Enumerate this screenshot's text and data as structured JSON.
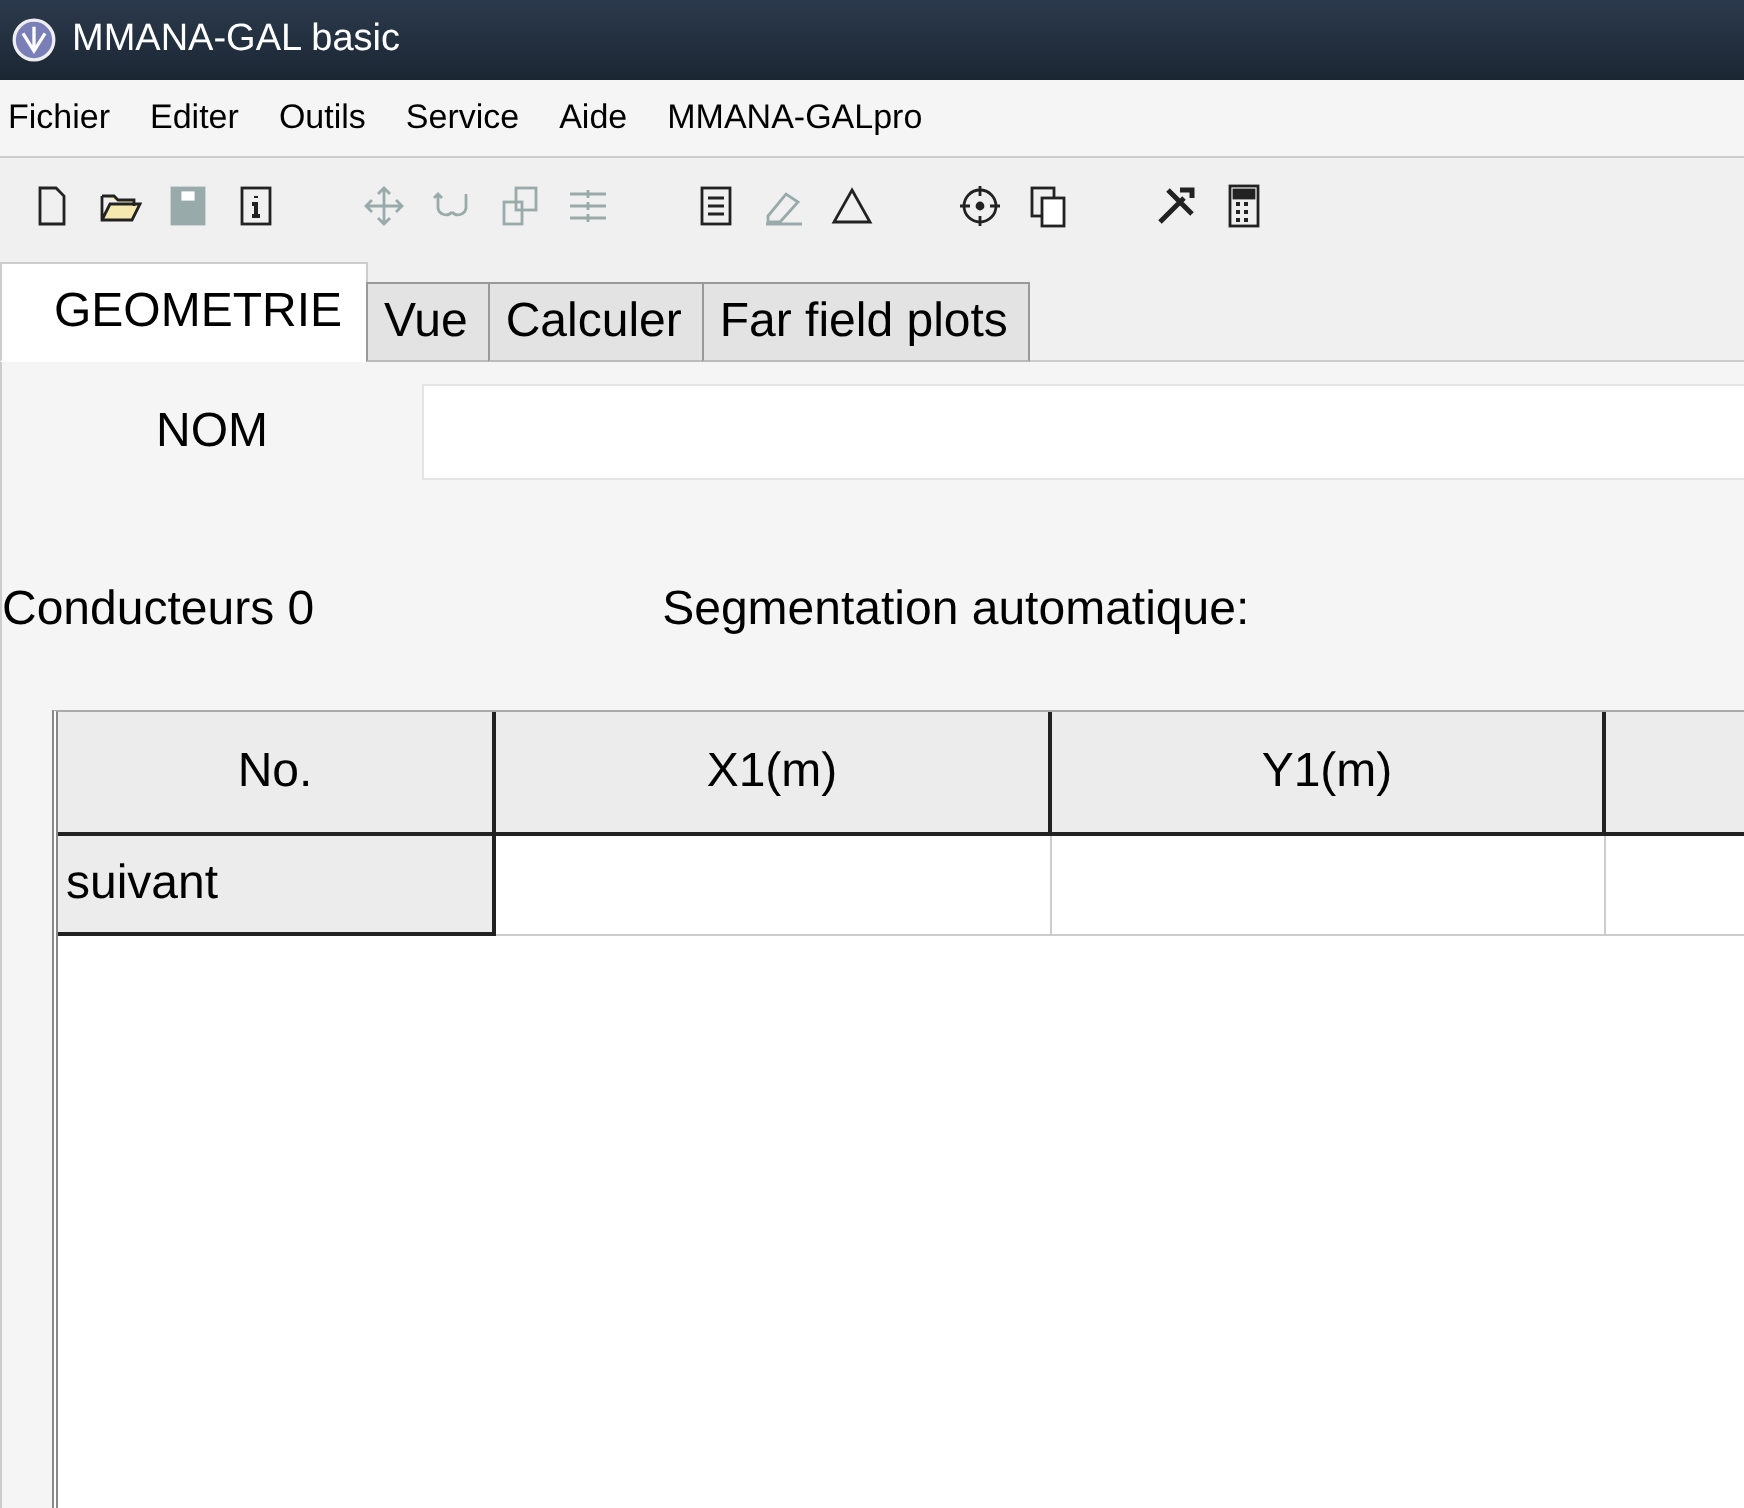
{
  "window": {
    "title": "MMANA-GAL basic"
  },
  "menu": [
    "Fichier",
    "Editer",
    "Outils",
    "Service",
    "Aide",
    "MMANA-GALpro"
  ],
  "toolbar": [
    {
      "kind": "new",
      "disabled": false
    },
    {
      "kind": "open",
      "disabled": false
    },
    {
      "kind": "save",
      "disabled": true
    },
    {
      "kind": "info",
      "disabled": false
    },
    {
      "kind": "gap"
    },
    {
      "kind": "move",
      "disabled": true
    },
    {
      "kind": "rotate",
      "disabled": true
    },
    {
      "kind": "copy",
      "disabled": true
    },
    {
      "kind": "lines",
      "disabled": true
    },
    {
      "kind": "gap"
    },
    {
      "kind": "doc",
      "disabled": false
    },
    {
      "kind": "eraser",
      "disabled": true
    },
    {
      "kind": "triangle",
      "disabled": false
    },
    {
      "kind": "gap"
    },
    {
      "kind": "target",
      "disabled": false
    },
    {
      "kind": "pages",
      "disabled": false
    },
    {
      "kind": "gap"
    },
    {
      "kind": "tools",
      "disabled": false
    },
    {
      "kind": "calc",
      "disabled": false
    }
  ],
  "tabs": [
    {
      "label": "GEOMETRIE",
      "selected": true
    },
    {
      "label": "Vue",
      "selected": false
    },
    {
      "label": "Calculer",
      "selected": false
    },
    {
      "label": "Far field plots",
      "selected": false
    }
  ],
  "name_field": {
    "label": "NOM"
  },
  "conductors": "Conducteurs 0",
  "segmentation": "Segmentation automatique:",
  "table": {
    "columns": [
      "No.",
      "X1(m)",
      "Y1(m)"
    ],
    "rows": [
      {
        "label": "suivant"
      }
    ]
  }
}
